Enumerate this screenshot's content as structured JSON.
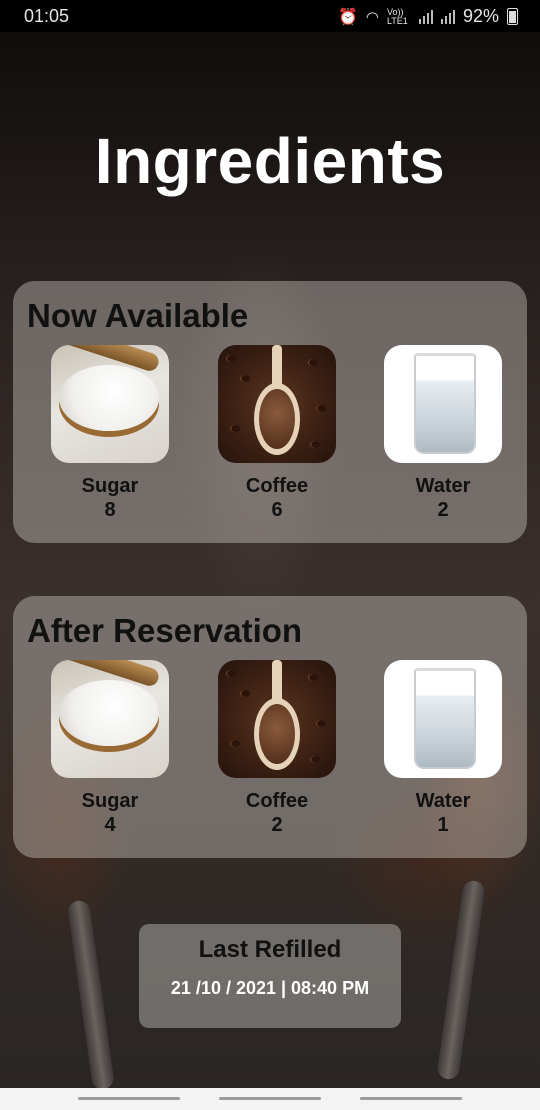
{
  "status_bar": {
    "time": "01:05",
    "lte_label": "Vo)) LTE1",
    "battery": "92%"
  },
  "page_title": "Ingredients",
  "now_available": {
    "title": "Now Available",
    "items": [
      {
        "label": "Sugar",
        "count": "8",
        "icon": "sugar-image"
      },
      {
        "label": "Coffee",
        "count": "6",
        "icon": "coffee-image"
      },
      {
        "label": "Water",
        "count": "2",
        "icon": "water-image"
      }
    ]
  },
  "after_reservation": {
    "title": "After Reservation",
    "items": [
      {
        "label": "Sugar",
        "count": "4",
        "icon": "sugar-image"
      },
      {
        "label": "Coffee",
        "count": "2",
        "icon": "coffee-image"
      },
      {
        "label": "Water",
        "count": "1",
        "icon": "water-image"
      }
    ]
  },
  "last_refilled": {
    "title": "Last Refilled",
    "date": "21 /10 / 2021 | 08:40 PM"
  },
  "colors": {
    "panel": "#cdc8c4",
    "title": "#ffffff",
    "text": "#111111"
  }
}
